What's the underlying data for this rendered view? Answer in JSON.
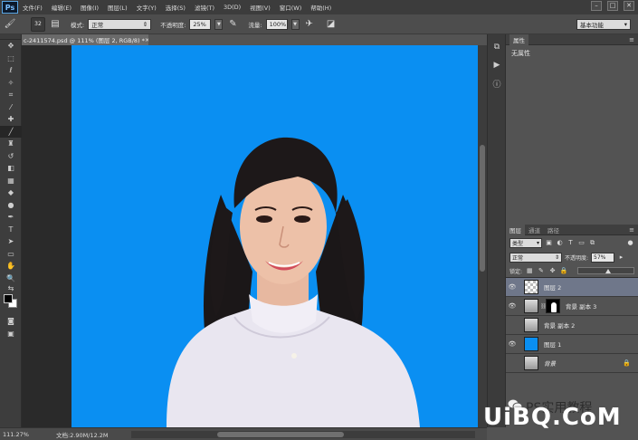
{
  "app": {
    "logo": "Ps"
  },
  "menu": [
    "文件(F)",
    "编辑(E)",
    "图像(I)",
    "图层(L)",
    "文字(Y)",
    "选择(S)",
    "滤镜(T)",
    "3D(D)",
    "视图(V)",
    "窗口(W)",
    "帮助(H)"
  ],
  "window_controls": {
    "minimize": "–",
    "restore": "□",
    "close": "✕"
  },
  "options": {
    "brush_size": "32",
    "mode_label": "模式:",
    "mode_value": "正常",
    "opacity_label": "不透明度:",
    "opacity_value": "25%",
    "flow_label": "流量:",
    "flow_value": "100%",
    "workspace": "基本功能"
  },
  "document": {
    "tab_title": "c-2411574.psd @ 111% (图层 2, RGB/8) *",
    "tab_close": "×",
    "zoom": "111.27%",
    "doc_info": "文档:2.90M/12.2M"
  },
  "properties": {
    "tab": "属性",
    "body": "无属性"
  },
  "layers_panel": {
    "tabs": [
      "图层",
      "通道",
      "路径"
    ],
    "filter_kind": "类型",
    "blend_mode": "正常",
    "opacity_label": "不透明度:",
    "opacity_value": "57%",
    "lock_label": "锁定:",
    "fill_label": "填充:",
    "fill_value": 0.5,
    "layers": [
      {
        "name": "图层 2",
        "visible": true,
        "selected": true,
        "thumb": "checker"
      },
      {
        "name": "背景 副本 3",
        "visible": true,
        "selected": false,
        "thumb": "portrait",
        "mask": true
      },
      {
        "name": "背景 副本 2",
        "visible": false,
        "selected": false,
        "thumb": "portrait"
      },
      {
        "name": "图层 1",
        "visible": true,
        "selected": false,
        "thumb": "blue"
      },
      {
        "name": "背景",
        "visible": false,
        "selected": false,
        "thumb": "portrait",
        "locked": true
      }
    ]
  },
  "watermark": {
    "cn": "PS实用教程",
    "url": "UiBQ.CoM"
  },
  "colors": {
    "canvas_blue": "#0a8ff2",
    "selected_layer": "#6f778a"
  }
}
